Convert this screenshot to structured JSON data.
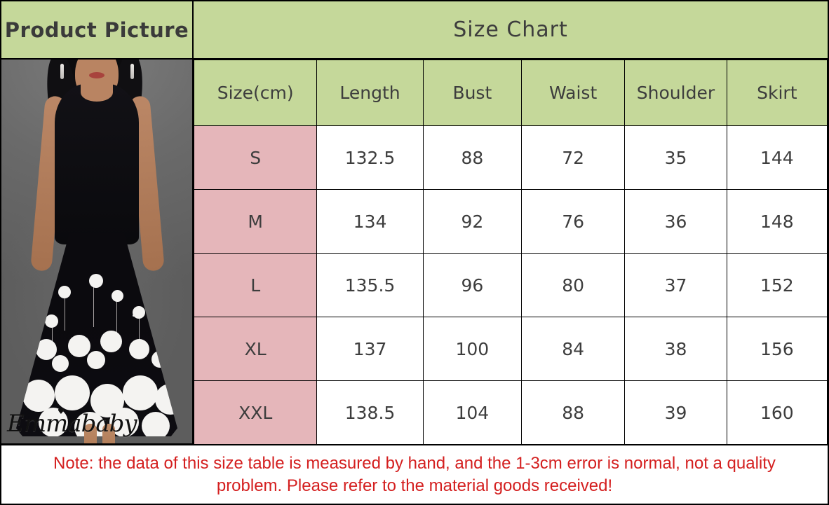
{
  "picture_panel": {
    "header_label": "Product Picture",
    "watermark": "Emmababy",
    "photo_alt": "Woman wearing black sleeveless floral print maxi dress on gray background"
  },
  "chart": {
    "title": "Size Chart",
    "headers": [
      "Size(cm)",
      "Length",
      "Bust",
      "Waist",
      "Shoulder",
      "Skirt"
    ],
    "rows": [
      {
        "size": "S",
        "length": "132.5",
        "bust": "88",
        "waist": "72",
        "shoulder": "35",
        "skirt": "144"
      },
      {
        "size": "M",
        "length": "134",
        "bust": "92",
        "waist": "76",
        "shoulder": "36",
        "skirt": "148"
      },
      {
        "size": "L",
        "length": "135.5",
        "bust": "96",
        "waist": "80",
        "shoulder": "37",
        "skirt": "152"
      },
      {
        "size": "XL",
        "length": "137",
        "bust": "100",
        "waist": "84",
        "shoulder": "38",
        "skirt": "156"
      },
      {
        "size": "XXL",
        "length": "138.5",
        "bust": "104",
        "waist": "88",
        "shoulder": "39",
        "skirt": "160"
      }
    ]
  },
  "note": {
    "text": "Note: the data of this size table is measured by hand, and the 1-3cm error is normal, not a quality problem. Please refer to the material goods received!"
  },
  "colors": {
    "header_green": "#C5D89A",
    "size_pink": "#E5B6BA",
    "text_dark": "#3D3D3D",
    "note_red": "#D41F1F",
    "border_black": "#000000",
    "photo_background_gray": "#6E6E6E"
  },
  "chart_data": {
    "type": "table",
    "title": "Size Chart",
    "columns": [
      "Size(cm)",
      "Length",
      "Bust",
      "Waist",
      "Shoulder",
      "Skirt"
    ],
    "categories": [
      "S",
      "M",
      "L",
      "XL",
      "XXL"
    ],
    "series": [
      {
        "name": "Length",
        "values": [
          132.5,
          134,
          135.5,
          137,
          138.5
        ]
      },
      {
        "name": "Bust",
        "values": [
          88,
          92,
          96,
          100,
          104
        ]
      },
      {
        "name": "Waist",
        "values": [
          72,
          76,
          80,
          84,
          88
        ]
      },
      {
        "name": "Shoulder",
        "values": [
          35,
          36,
          37,
          38,
          39
        ]
      },
      {
        "name": "Skirt",
        "values": [
          144,
          148,
          152,
          156,
          160
        ]
      }
    ],
    "unit": "cm",
    "note": "Note: the data of this size table is measured by hand, and the 1-3cm error is normal, not a quality problem. Please refer to the material goods received!"
  }
}
